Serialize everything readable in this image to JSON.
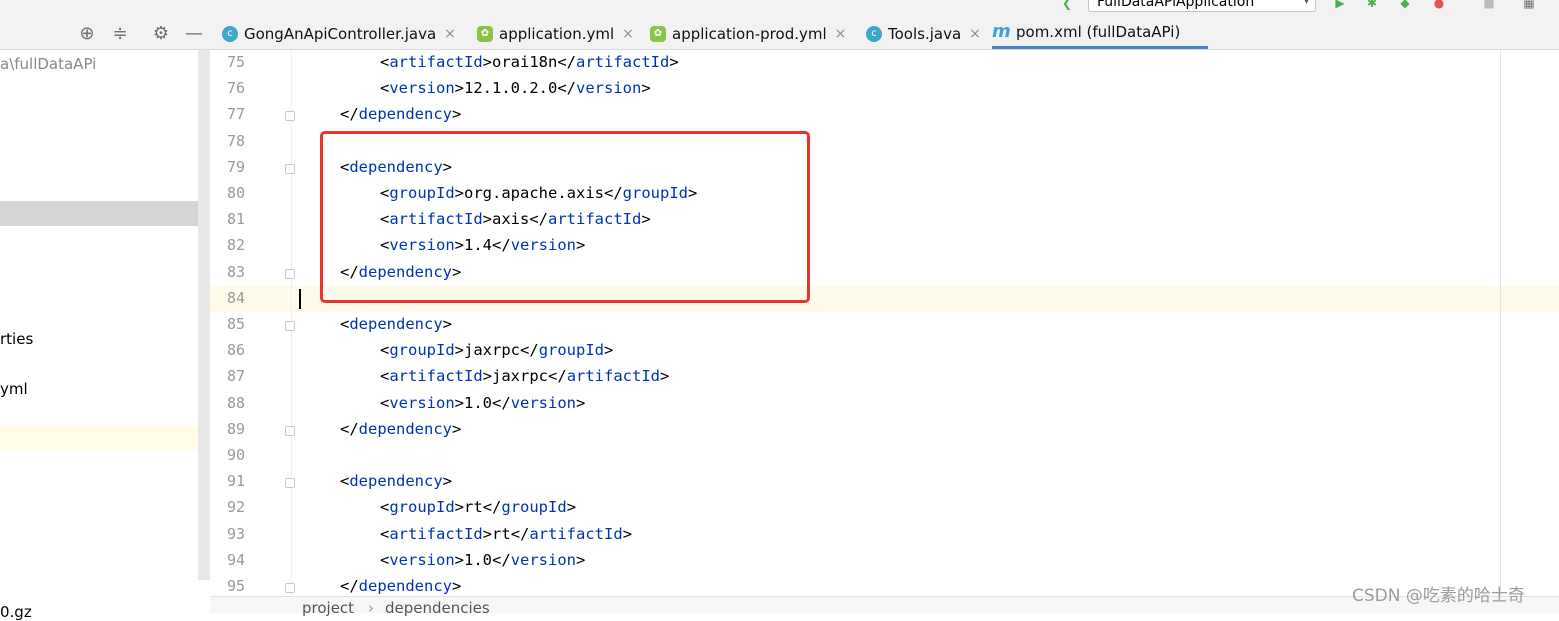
{
  "toolbar": {
    "run_config": "FullDataAPiApplication",
    "icons": [
      "hammer-icon",
      "run-icon",
      "debug-icon",
      "coverage-icon",
      "profile-icon",
      "stop-icon",
      "window-icon"
    ]
  },
  "tool_window_icons": [
    "locate-icon",
    "collapse-icon",
    "gear-icon",
    "hide-icon"
  ],
  "tabs": [
    {
      "label": "GongAnApiController.java",
      "icon": "java-class-icon",
      "glyph": "c"
    },
    {
      "label": "application.yml",
      "icon": "spring-yml-icon",
      "glyph": "✿"
    },
    {
      "label": "application-prod.yml",
      "icon": "spring-yml-icon",
      "glyph": "✿"
    },
    {
      "label": "Tools.java",
      "icon": "java-class-icon",
      "glyph": "c"
    },
    {
      "label": "pom.xml (fullDataAPi)",
      "icon": "maven-icon",
      "glyph": "m",
      "active": true
    }
  ],
  "close_glyph": "×",
  "sidebar": {
    "path_fragment": "a\\fullDataAPi",
    "items": [
      "rties",
      "yml",
      "0.gz"
    ]
  },
  "editor": {
    "lines": [
      {
        "n": "75",
        "indent": 2,
        "open": "artifactId",
        "value": "orai18n"
      },
      {
        "n": "76",
        "indent": 2,
        "open": "version",
        "value": "12.1.0.2.0"
      },
      {
        "n": "77",
        "indent": 1,
        "close_only": "dependency"
      },
      {
        "n": "78",
        "indent": 0
      },
      {
        "n": "79",
        "indent": 1,
        "open_only": "dependency"
      },
      {
        "n": "80",
        "indent": 2,
        "open": "groupId",
        "value": "org.apache.axis"
      },
      {
        "n": "81",
        "indent": 2,
        "open": "artifactId",
        "value": "axis"
      },
      {
        "n": "82",
        "indent": 2,
        "open": "version",
        "value": "1.4"
      },
      {
        "n": "83",
        "indent": 1,
        "close_only": "dependency"
      },
      {
        "n": "84",
        "indent": 0
      },
      {
        "n": "85",
        "indent": 1,
        "open_only": "dependency"
      },
      {
        "n": "86",
        "indent": 2,
        "open": "groupId",
        "value": "jaxrpc"
      },
      {
        "n": "87",
        "indent": 2,
        "open": "artifactId",
        "value": "jaxrpc"
      },
      {
        "n": "88",
        "indent": 2,
        "open": "version",
        "value": "1.0"
      },
      {
        "n": "89",
        "indent": 1,
        "close_only": "dependency"
      },
      {
        "n": "90",
        "indent": 0
      },
      {
        "n": "91",
        "indent": 1,
        "open_only": "dependency"
      },
      {
        "n": "92",
        "indent": 2,
        "open": "groupId",
        "value": "rt"
      },
      {
        "n": "93",
        "indent": 2,
        "open": "artifactId",
        "value": "rt"
      },
      {
        "n": "94",
        "indent": 2,
        "open": "version",
        "value": "1.0"
      },
      {
        "n": "95",
        "indent": 1,
        "close_only": "dependency"
      }
    ],
    "fold_lines": [
      "77",
      "79",
      "83",
      "85",
      "89",
      "91",
      "95"
    ]
  },
  "breadcrumb": [
    "project",
    "dependencies"
  ],
  "breadcrumb_sep": "›",
  "watermark": "CSDN @吃素的哈士奇",
  "colors": {
    "tag": "#0033b3",
    "highlight_box": "#e8362f",
    "active_tab_underline": "#4083c9"
  }
}
